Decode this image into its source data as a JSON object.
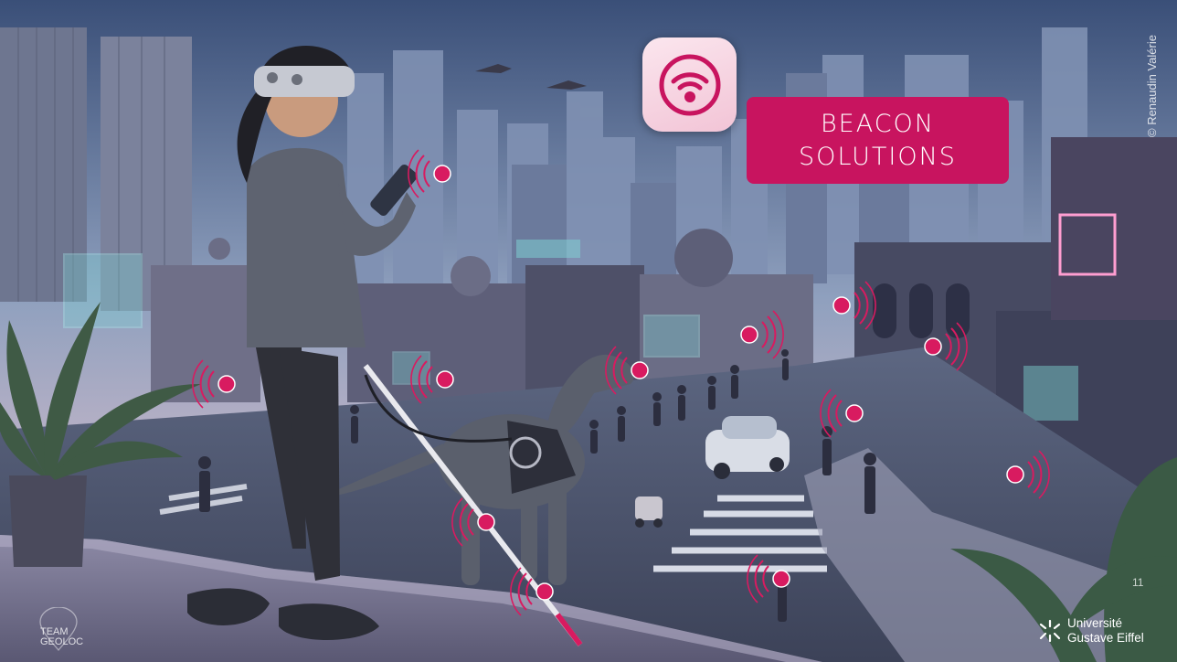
{
  "slide": {
    "title_line1": "BEACON",
    "title_line2": "SOLUTIONS",
    "credit": "© Renaudin Valérie",
    "page_number": "11"
  },
  "logos": {
    "team_line1": "TEAM",
    "team_line2": "GEOLOC",
    "university_line1": "Université",
    "university_line2": "Gustave Eiffel"
  },
  "icons": {
    "app_icon": "wifi-beacon-icon",
    "university_icon": "eiffel-burst-icon"
  },
  "colors": {
    "accent": "#c8145f",
    "beacon_marker": "#d81b60"
  }
}
